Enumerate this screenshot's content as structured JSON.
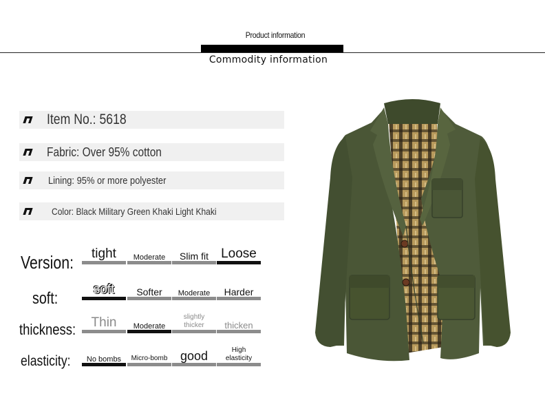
{
  "header": {
    "subtitle": "Product information",
    "title": "Commodity information"
  },
  "info": {
    "item_no": "Item No.: 5618",
    "fabric": "Fabric: Over 95% cotton",
    "lining": "Lining: 95% or more polyester",
    "color": "Color: Black Military Green Khaki Light Khaki"
  },
  "attributes": {
    "version": {
      "label": "Version:",
      "options": [
        "tight",
        "Moderate",
        "Slim fit",
        "Loose"
      ]
    },
    "soft": {
      "label": "soft:",
      "options": [
        "soft",
        "Softer",
        "Moderate",
        "Harder"
      ]
    },
    "thickness": {
      "label": "thickness:",
      "options": [
        "Thin",
        "Moderate",
        "slightly thicker",
        "thicken"
      ]
    },
    "elasticity": {
      "label": "elasticity:",
      "options": [
        "No bombs",
        "Micro-bomb",
        "good",
        "High elasticity"
      ]
    }
  },
  "product_image": {
    "icon": "blazer-jacket",
    "colors": {
      "body": "#4a5636",
      "lining": "#b89a5c",
      "lining_check": "#2c2418",
      "button": "#6b3a22"
    }
  }
}
